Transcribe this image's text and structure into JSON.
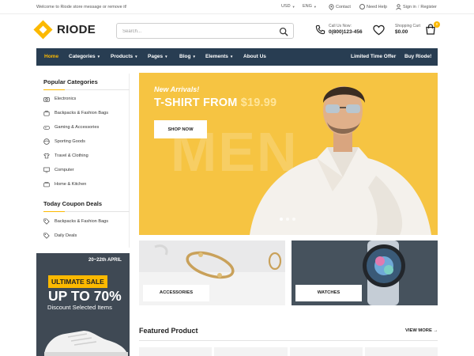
{
  "topbar": {
    "welcome": "Welcome to Riode store message or remove it!",
    "currency": "USD",
    "language": "ENG",
    "contact": "Contact",
    "help": "Need Help",
    "signin": "Sign in",
    "divider": "/",
    "register": "Register"
  },
  "header": {
    "brand": "RIODE",
    "search_placeholder": "Search...",
    "call_label": "Call Us Now:",
    "phone": "0(800)123-456",
    "cart_label": "Shopping Cart",
    "cart_total": "$0.00",
    "cart_count": "0"
  },
  "nav": {
    "items": [
      "Home",
      "Categories",
      "Products",
      "Pages",
      "Blog",
      "Elements",
      "About Us"
    ],
    "right": [
      "Limited Time Offer",
      "Buy Riode!"
    ]
  },
  "sidebar": {
    "popular_title": "Popular Categories",
    "categories": [
      "Electronics",
      "Backpacks & Fashion Bags",
      "Gaming & Accessories",
      "Sporting Goods",
      "Travel & Clothing",
      "Computer",
      "Home & Kitchen"
    ],
    "coupon_title": "Today Coupon Deals",
    "coupons": [
      "Backpacks & Fashion Bags",
      "Daily Deals"
    ]
  },
  "hero": {
    "kicker": "New Arrivals!",
    "headline": "T-SHIRT FROM",
    "price": "$19.99",
    "bg_text": "MEN",
    "button": "SHOP NOW"
  },
  "tiles": {
    "accessories": "ACCESSORIES",
    "watches": "WATCHES"
  },
  "sale": {
    "date": "20~22th APRIL",
    "pill": "ULTIMATE SALE",
    "upto": "UP TO 70%",
    "discount": "Discount Selected Items"
  },
  "featured": {
    "title": "Featured Product",
    "view_more": "VIEW MORE"
  },
  "colors": {
    "accent": "#fcb900",
    "nav_bg": "#283d52",
    "hero_bg": "#f6c442",
    "sale_bg": "#3f4954"
  }
}
